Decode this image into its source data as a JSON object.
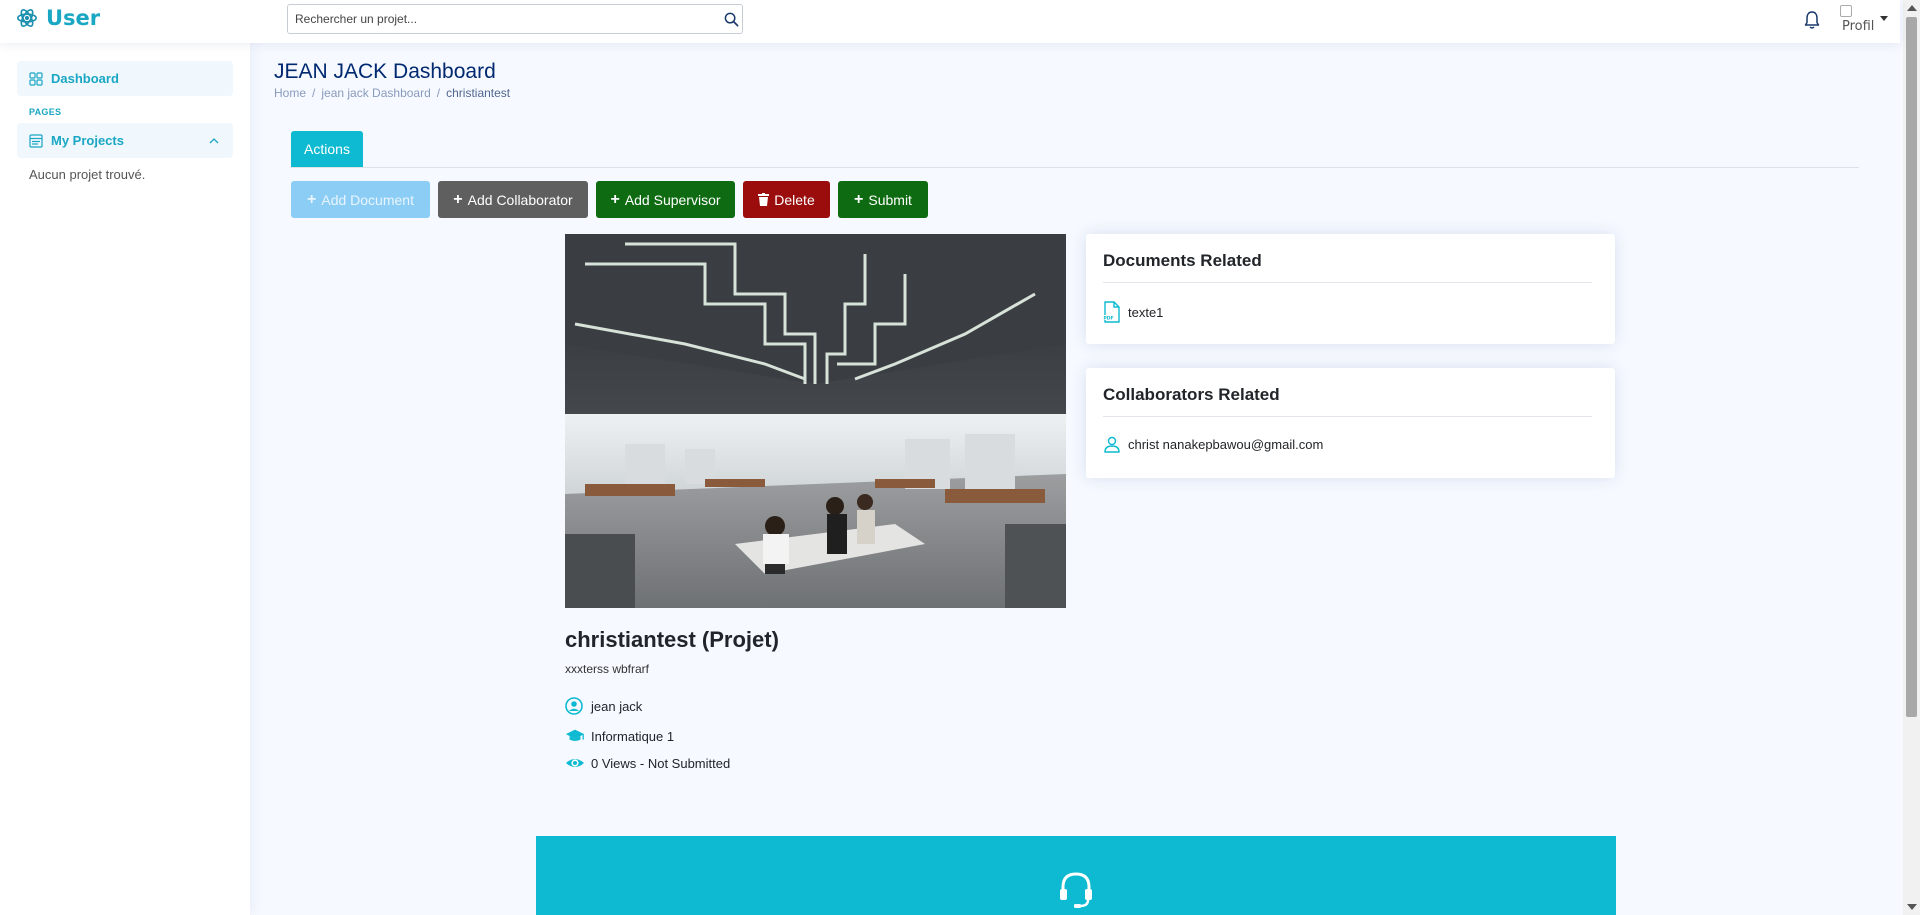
{
  "header": {
    "app_name": "User",
    "search_placeholder": "Rechercher un projet...",
    "profile_alt": "Profil"
  },
  "sidebar": {
    "dashboard_label": "Dashboard",
    "pages_heading": "PAGES",
    "my_projects_label": "My Projects",
    "empty_text": "Aucun projet trouvé."
  },
  "page": {
    "title": "JEAN JACK Dashboard",
    "breadcrumb": [
      "Home",
      "jean jack Dashboard",
      "christiantest"
    ],
    "tab_label": "Actions"
  },
  "actions": {
    "add_document": "Add Document",
    "add_collaborator": "Add Collaborator",
    "add_supervisor": "Add Supervisor",
    "delete": "Delete",
    "submit": "Submit"
  },
  "project": {
    "title": "christiantest (Projet)",
    "description": "xxxterss wbfrarf",
    "owner": "jean jack",
    "class": "Informatique 1",
    "status": "0 Views - Not Submitted"
  },
  "documents_card": {
    "title": "Documents Related",
    "items": [
      "texte1"
    ]
  },
  "collaborators_card": {
    "title": "Collaborators Related",
    "items": [
      "christ nanakepbawou@gmail.com"
    ]
  },
  "colors": {
    "brand": "#1aa7c4",
    "accent": "#0dbad1",
    "title_navy": "#012970",
    "success": "#0e6b11",
    "danger": "#9b0c0c",
    "secondary": "#5f5f5f",
    "disabled_primary": "#8ccdf6"
  }
}
